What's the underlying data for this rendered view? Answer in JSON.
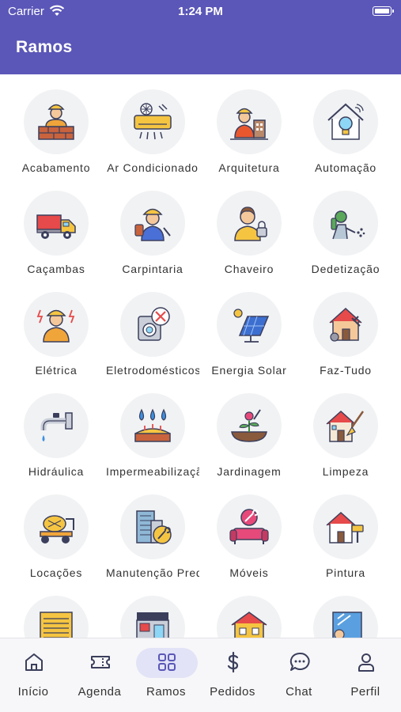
{
  "status_bar": {
    "carrier": "Carrier",
    "time": "1:24 PM"
  },
  "header": {
    "title": "Ramos"
  },
  "categories": [
    {
      "label": "Acabamento",
      "icon": "worker-bricks-icon"
    },
    {
      "label": "Ar Condicionado",
      "icon": "air-conditioner-icon"
    },
    {
      "label": "Arquitetura",
      "icon": "architect-icon"
    },
    {
      "label": "Automação",
      "icon": "smart-home-icon"
    },
    {
      "label": "Caçambas",
      "icon": "dump-truck-icon"
    },
    {
      "label": "Carpintaria",
      "icon": "carpenter-icon"
    },
    {
      "label": "Chaveiro",
      "icon": "locksmith-icon"
    },
    {
      "label": "Dedetização",
      "icon": "pest-control-icon"
    },
    {
      "label": "Elétrica",
      "icon": "electrician-icon"
    },
    {
      "label": "Eletrodomésticos",
      "icon": "appliance-repair-icon"
    },
    {
      "label": "Energia Solar",
      "icon": "solar-panel-icon"
    },
    {
      "label": "Faz-Tudo",
      "icon": "handyman-house-icon"
    },
    {
      "label": "Hidráulica",
      "icon": "faucet-icon"
    },
    {
      "label": "Impermeabilização",
      "icon": "waterproofing-icon"
    },
    {
      "label": "Jardinagem",
      "icon": "gardening-icon"
    },
    {
      "label": "Limpeza",
      "icon": "cleaning-house-icon"
    },
    {
      "label": "Locações",
      "icon": "cement-mixer-icon"
    },
    {
      "label": "Manutenção Predial",
      "icon": "building-maintenance-icon"
    },
    {
      "label": "Móveis",
      "icon": "sofa-repair-icon"
    },
    {
      "label": "Pintura",
      "icon": "paint-house-icon"
    },
    {
      "label": "",
      "icon": "garage-door-icon"
    },
    {
      "label": "",
      "icon": "storefront-icon"
    },
    {
      "label": "",
      "icon": "house-inspection-icon"
    },
    {
      "label": "",
      "icon": "glass-cleaning-icon"
    }
  ],
  "tabs": [
    {
      "label": "Início",
      "icon": "home-icon",
      "active": false
    },
    {
      "label": "Agenda",
      "icon": "ticket-icon",
      "active": false
    },
    {
      "label": "Ramos",
      "icon": "grid-icon",
      "active": true
    },
    {
      "label": "Pedidos",
      "icon": "dollar-icon",
      "active": false
    },
    {
      "label": "Chat",
      "icon": "chat-bubble-icon",
      "active": false
    },
    {
      "label": "Perfil",
      "icon": "person-icon",
      "active": false
    }
  ],
  "colors": {
    "primary": "#5b57b8",
    "tab_active_bg": "#e2e3f6",
    "icon_stroke": "#3b3f5c"
  }
}
